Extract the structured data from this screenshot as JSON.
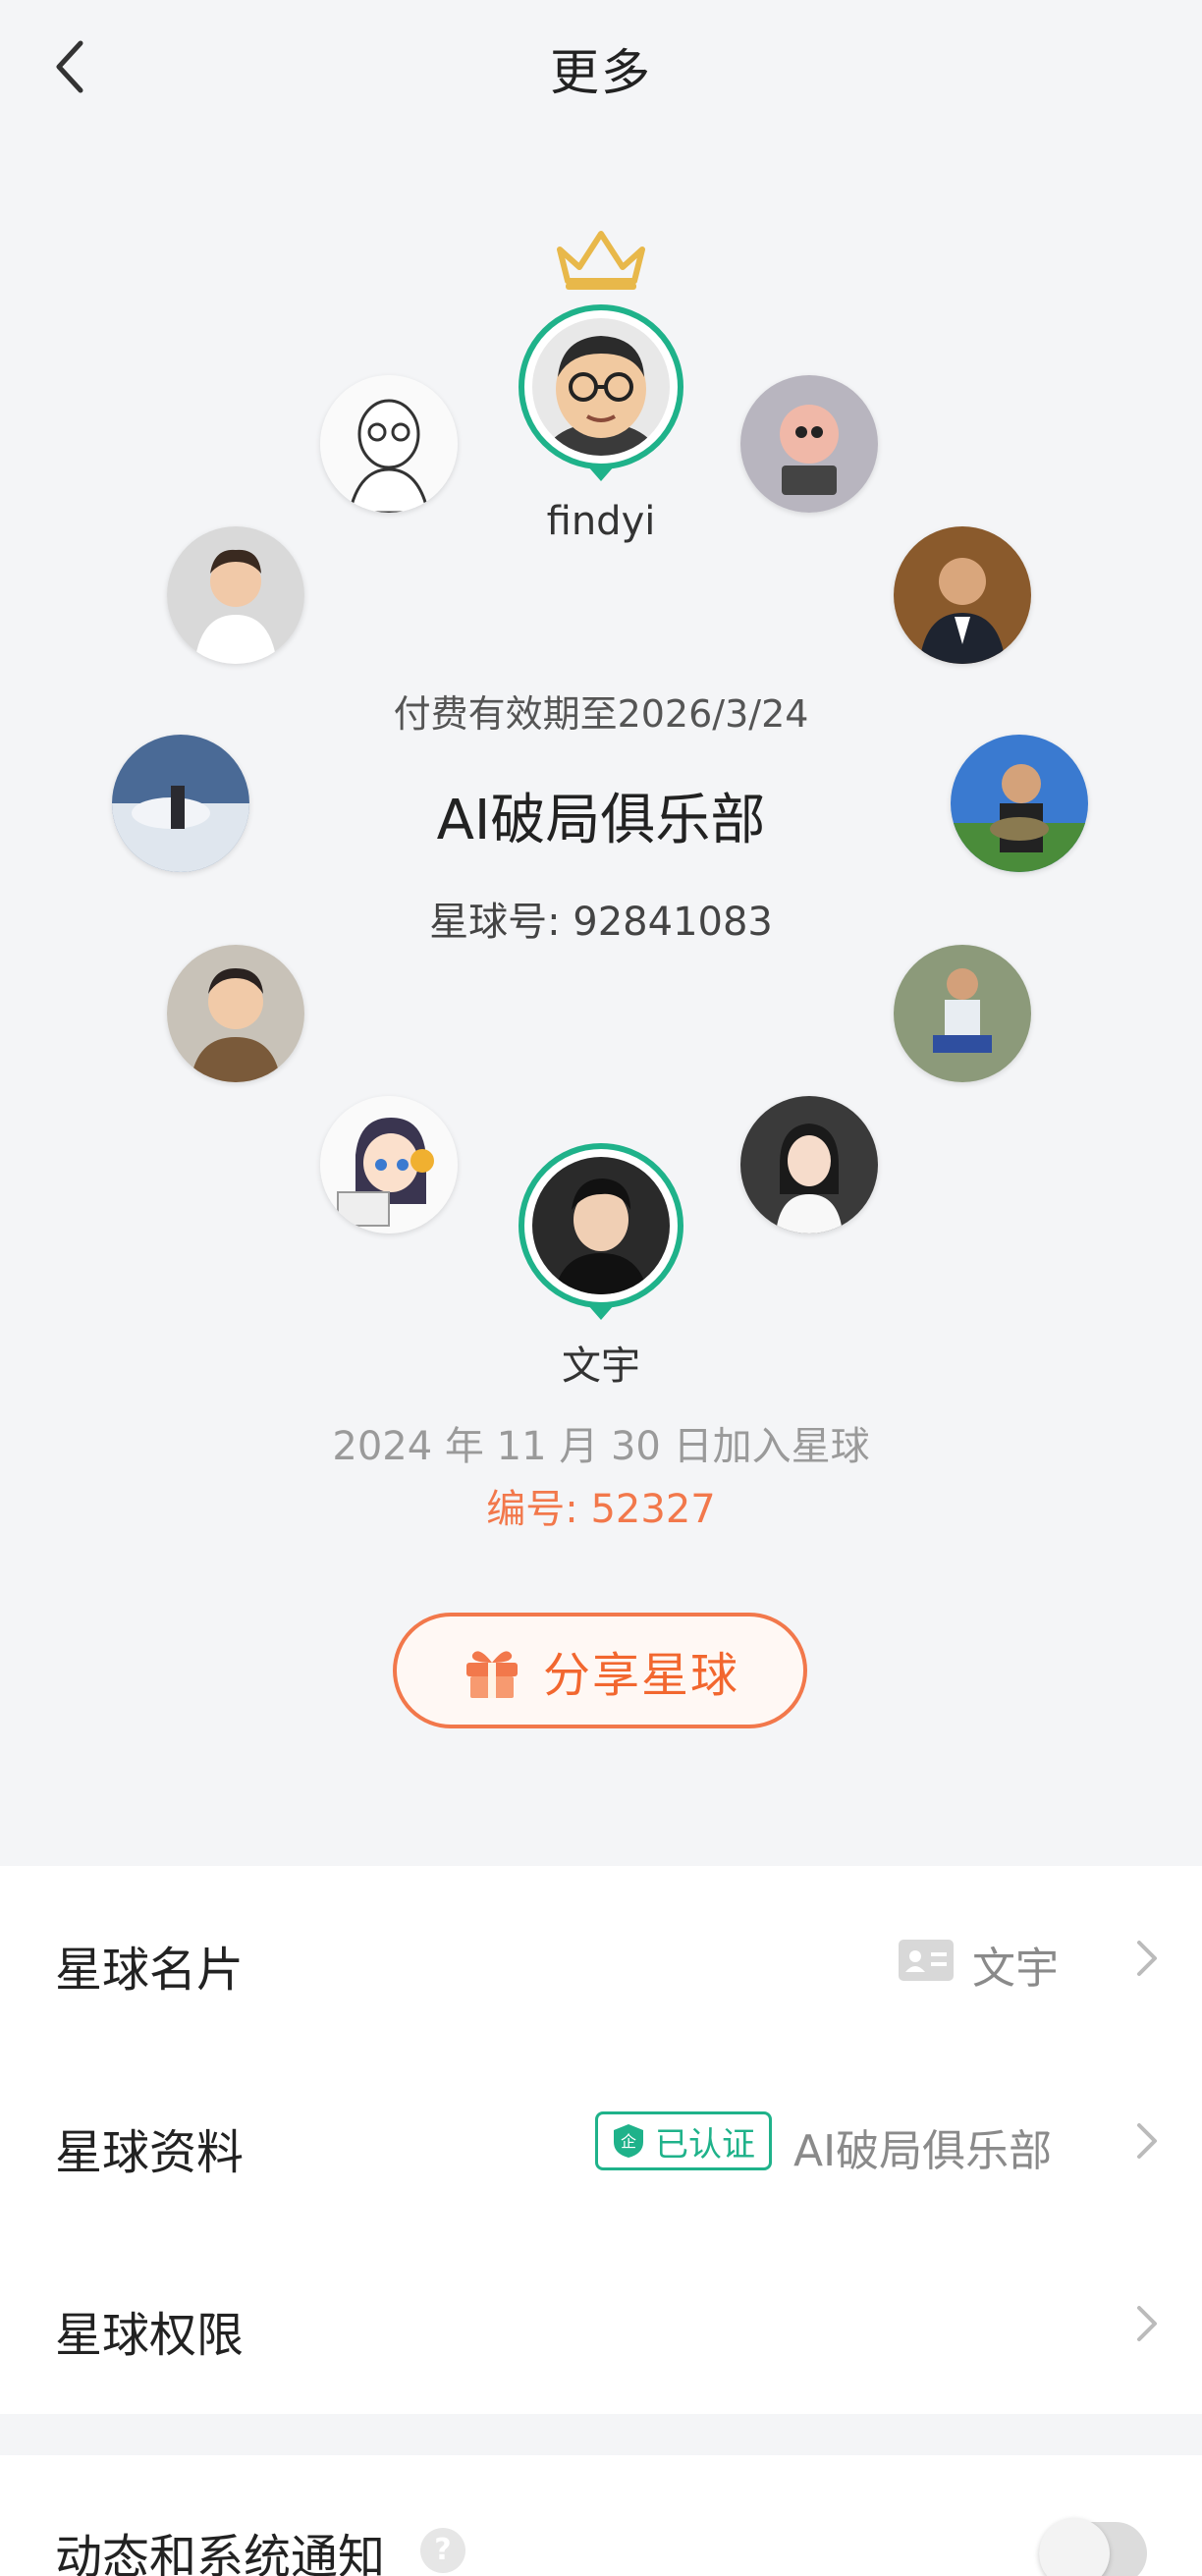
{
  "header": {
    "title": "更多",
    "back_icon": "chevron-left-icon"
  },
  "owner": {
    "name": "findyi",
    "badge": "crown-icon"
  },
  "me": {
    "name": "文宇"
  },
  "group": {
    "valid_until": "付费有效期至2026/3/24",
    "name": "AI破局俱乐部",
    "id_text": "星球号: 92841083",
    "join_date": "2024 年 11 月 30 日加入星球",
    "member_no": "编号: 52327"
  },
  "share_button": {
    "label": "分享星球",
    "icon": "gift-icon"
  },
  "settings": {
    "card": {
      "title": "星球名片",
      "value": "文宇",
      "icon": "id-card-icon"
    },
    "profile": {
      "title": "星球资料",
      "verified": "已认证",
      "value": "AI破局俱乐部",
      "verified_icon": "shield-enterprise-icon"
    },
    "permissions": {
      "title": "星球权限"
    },
    "notifications": {
      "title": "动态和系统通知",
      "help": "?",
      "toggle_on": false
    }
  },
  "colors": {
    "accent_green": "#1fb28a",
    "accent_orange": "#f2784b",
    "crown": "#e8b84a"
  }
}
